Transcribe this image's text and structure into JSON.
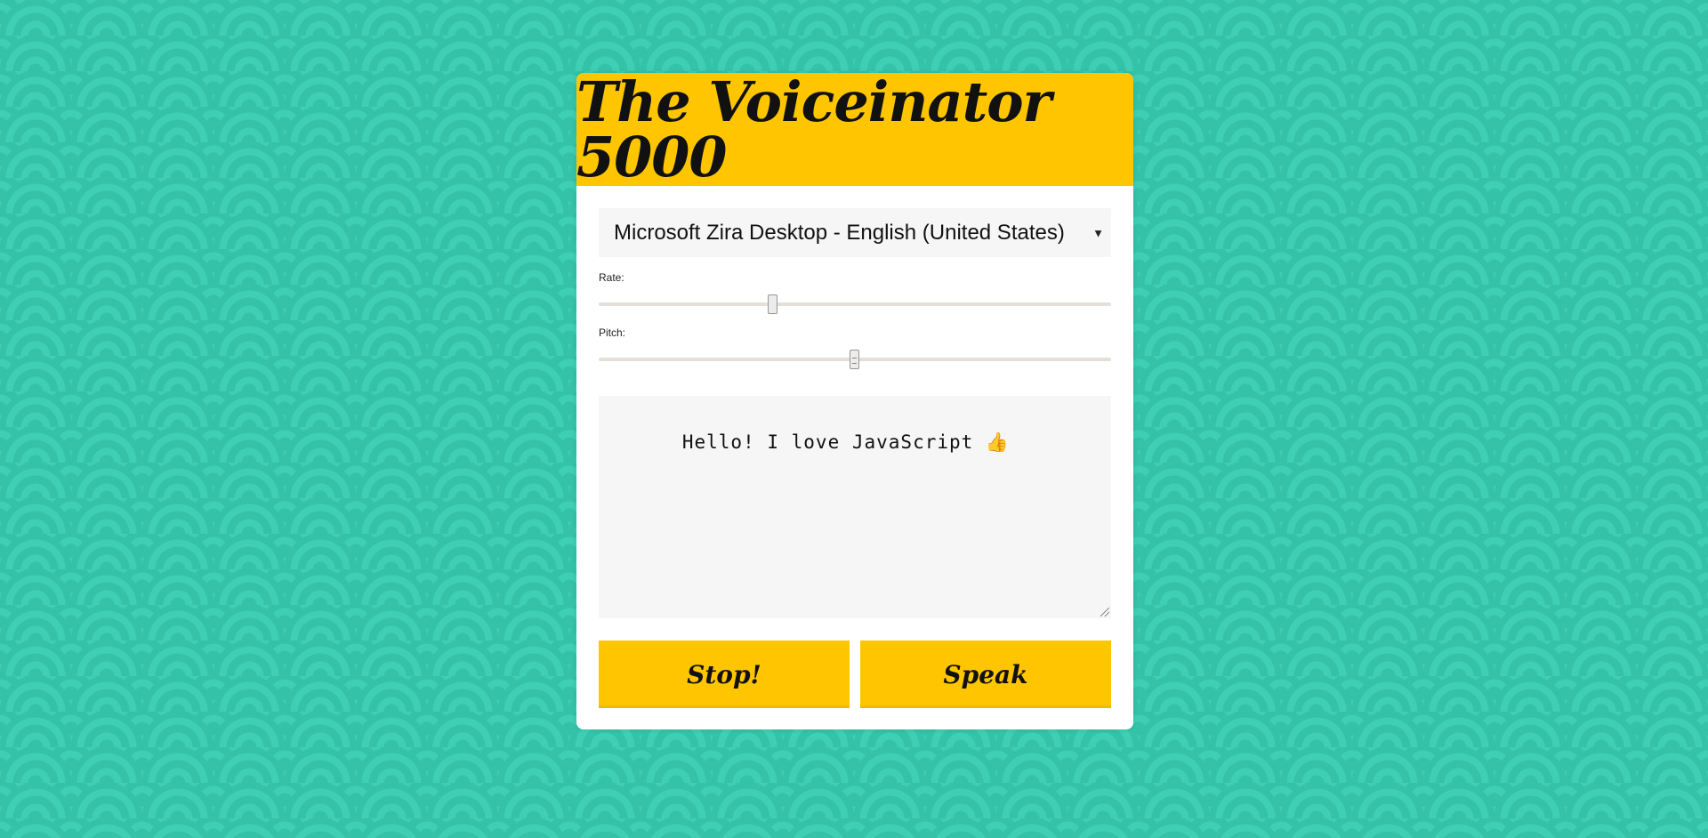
{
  "app": {
    "title": "The Voiceinator 5000"
  },
  "voice_select": {
    "selected": "Microsoft Zira Desktop - English (United States)",
    "chevron": "▼",
    "icon": "chevron-down-icon"
  },
  "rate": {
    "label": "Rate:",
    "value_fraction": 0.34
  },
  "pitch": {
    "label": "Pitch:",
    "value_fraction": 0.5
  },
  "message": {
    "text": "Hello! I love JavaScript 👍"
  },
  "buttons": {
    "stop_label": "Stop!",
    "speak_label": "Speak"
  },
  "colors": {
    "accent": "#ffc600",
    "background": "#3ecfb5",
    "panel": "#ffffff",
    "field": "#f6f6f6"
  }
}
